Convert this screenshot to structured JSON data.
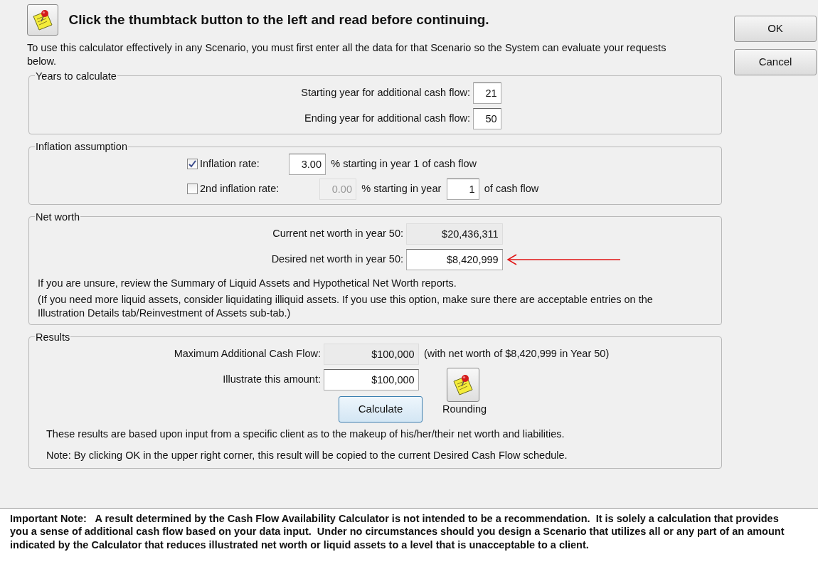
{
  "header": {
    "title": "Click the thumbtack button to the left and read before continuing."
  },
  "intro": "To use this calculator effectively in any Scenario, you must first enter all the data for that Scenario so the System can evaluate your requests below.",
  "buttons": [
    {
      "label": "OK"
    },
    {
      "label": "Cancel"
    }
  ],
  "years": {
    "legend": "Years to calculate",
    "fields": [
      {
        "label": "Starting year for additional cash flow:",
        "value": "21"
      },
      {
        "label": "Ending year for additional cash flow:",
        "value": "50"
      }
    ]
  },
  "inflation": {
    "legend": "Inflation assumption",
    "rows": [
      {
        "label": "Inflation rate:",
        "checked": true,
        "rate": "3.00",
        "text": "% starting in year 1 of cash flow"
      },
      {
        "label": "2nd inflation rate:",
        "checked": false,
        "rate": "0.00",
        "text": "% starting in year",
        "year": "1",
        "suffix": "of cash flow"
      }
    ]
  },
  "net_worth": {
    "legend": "Net worth",
    "fields": [
      {
        "label": "Current net worth in year 50:",
        "value": "$20,436,311",
        "disabled": true,
        "pointed": false
      },
      {
        "label": "Desired net worth in year 50:",
        "value": "$8,420,999",
        "disabled": false,
        "pointed": true
      }
    ],
    "notes": [
      "If you are unsure, review the Summary of Liquid Assets and Hypothetical Net Worth reports.",
      "(If you need more liquid assets, consider liquidating illiquid assets. If you use this option, make sure there are acceptable entries on the Illustration Details tab/Reinvestment of Assets sub-tab.)"
    ]
  },
  "results": {
    "legend": "Results",
    "fields": [
      {
        "label": "Maximum Additional Cash Flow:",
        "value": "$100,000",
        "disabled": true,
        "note": "(with net worth of $8,420,999 in Year 50)"
      },
      {
        "label": "Illustrate this amount:",
        "value": "$100,000",
        "disabled": false
      }
    ],
    "calculate": "Calculate",
    "rounding": "Rounding",
    "notes": [
      "These results are based upon input from a specific client as to the makeup of his/her/their net worth and liabilities.",
      "Note: By clicking OK in the upper right corner, this result will be copied to the current Desired Cash Flow schedule."
    ]
  },
  "footer": "Important Note:   A result determined by the Cash Flow Availability Calculator is not intended to be a recommendation.  It is solely a calculation that provides you a sense of additional cash flow based on your data input.  Under no circumstances should you design a Scenario that utilizes all or any part of an amount indicated by the Calculator that reduces illustrated net worth or liquid assets to a level that is unacceptable to a client."
}
